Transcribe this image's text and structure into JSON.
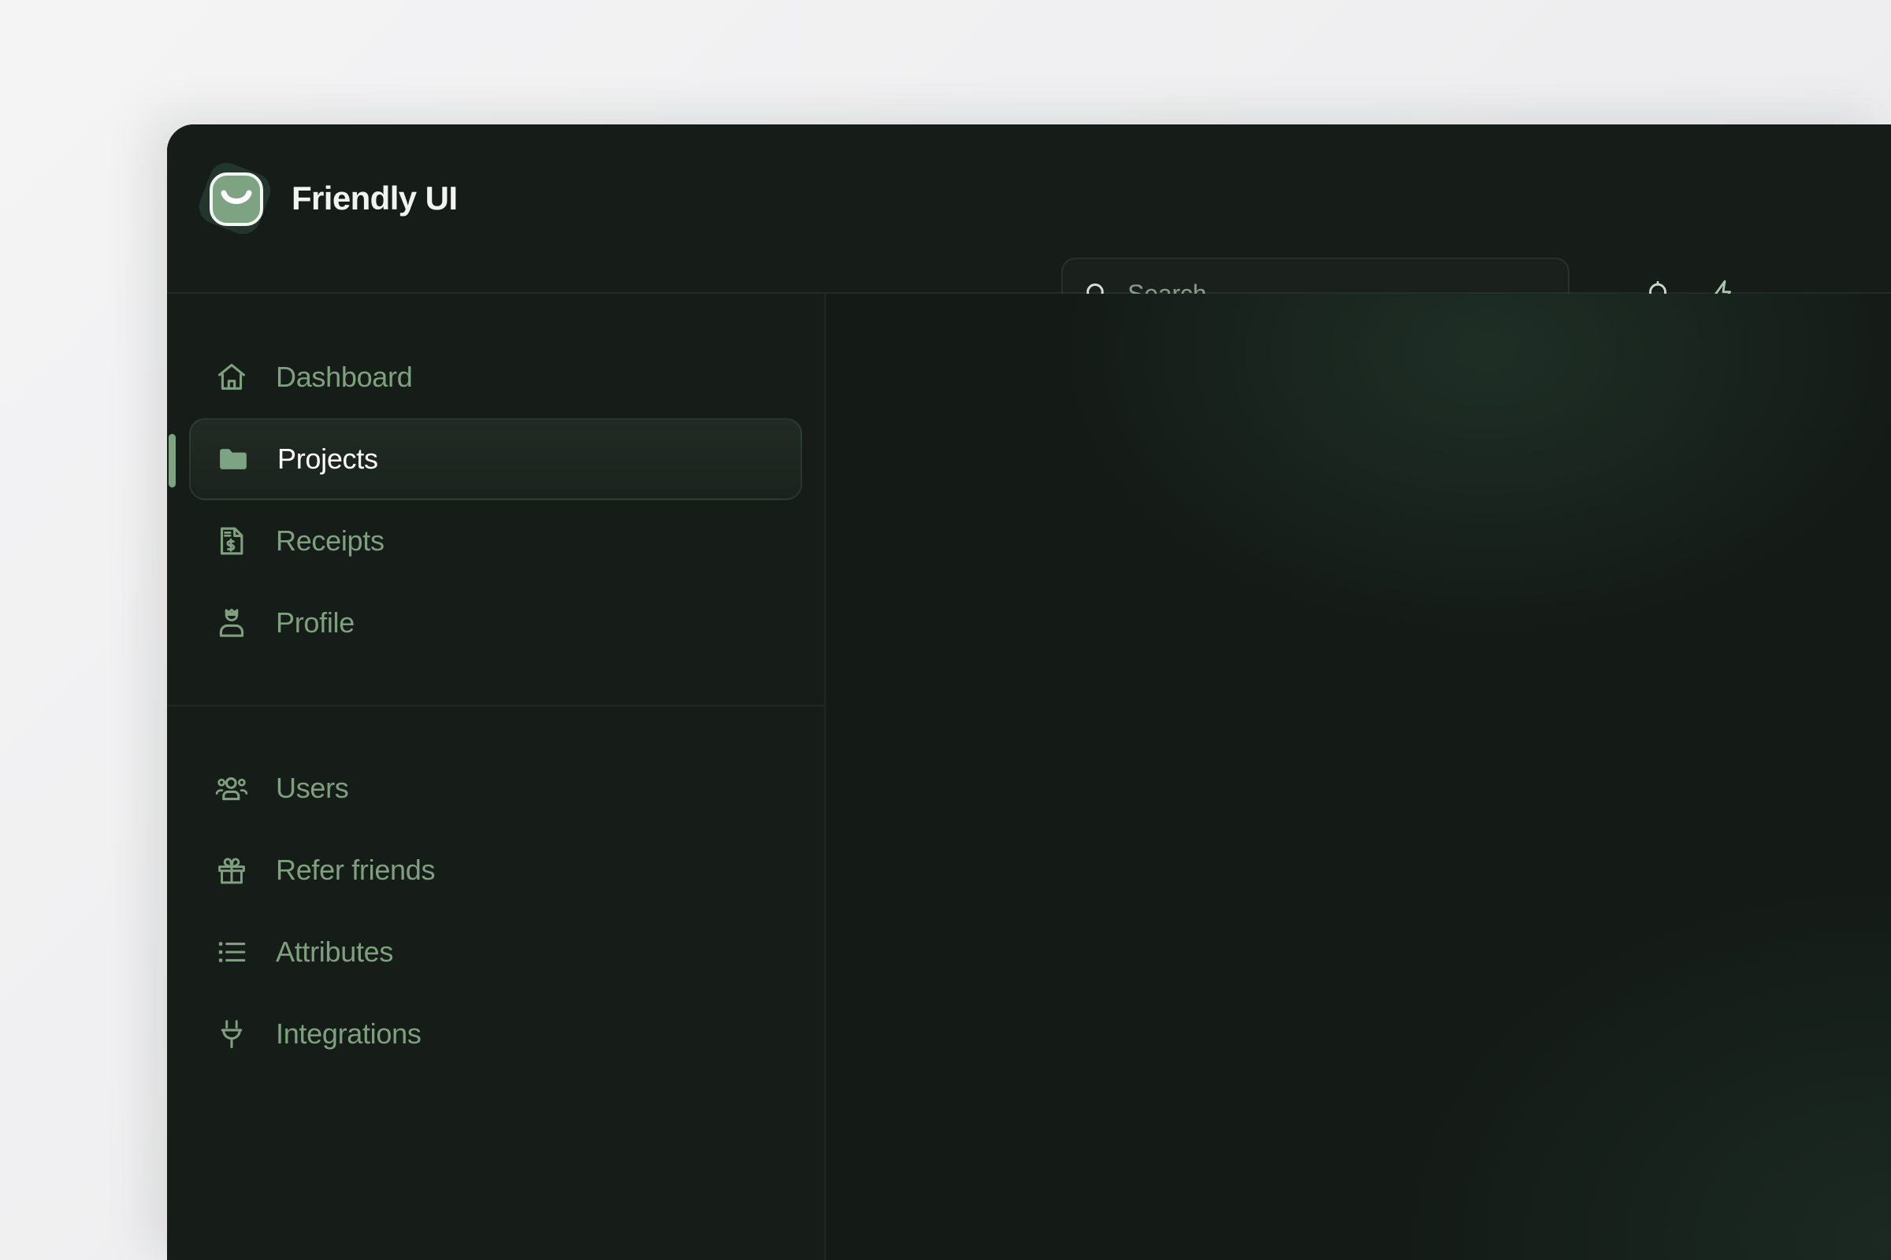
{
  "brand": {
    "name": "Friendly UI",
    "logo_icon": "smile-logo-icon",
    "accent_color": "#7ea383",
    "logo_back_color": "#22362c"
  },
  "header": {
    "search": {
      "placeholder": "Search...",
      "value": "",
      "icon": "search-icon"
    },
    "actions": [
      {
        "name": "notifications",
        "icon": "bell-icon"
      },
      {
        "name": "quick-actions",
        "icon": "lightning-bolt-icon"
      }
    ]
  },
  "sidebar": {
    "groups": [
      {
        "name": "primary",
        "items": [
          {
            "label": "Dashboard",
            "icon": "home-icon",
            "active": false
          },
          {
            "label": "Projects",
            "icon": "folder-icon",
            "active": true
          },
          {
            "label": "Receipts",
            "icon": "receipt-icon",
            "active": false
          },
          {
            "label": "Profile",
            "icon": "user-crown-icon",
            "active": false
          }
        ]
      },
      {
        "name": "secondary",
        "items": [
          {
            "label": "Users",
            "icon": "users-icon",
            "active": false
          },
          {
            "label": "Refer friends",
            "icon": "gift-icon",
            "active": false
          },
          {
            "label": "Attributes",
            "icon": "list-icon",
            "active": false
          },
          {
            "label": "Integrations",
            "icon": "plug-icon",
            "active": false
          }
        ]
      }
    ]
  },
  "theme": {
    "sidebar_bg": "#161d18",
    "content_bg": "#141a16",
    "muted_text": "#7fa07f",
    "active_text": "#ffffff",
    "page_bg": "#f2f2f3"
  }
}
